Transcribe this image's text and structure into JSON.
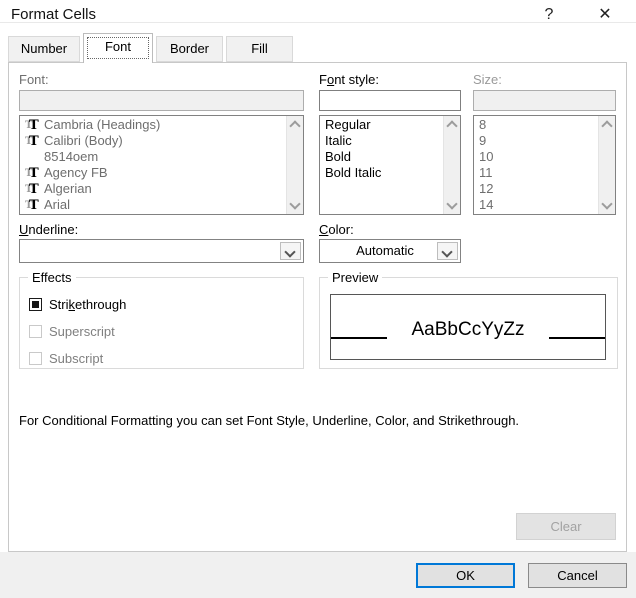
{
  "window": {
    "title": "Format Cells",
    "help_glyph": "?",
    "close_glyph": "✕"
  },
  "tabs": [
    {
      "label": "Number",
      "selected": false
    },
    {
      "label": "Font",
      "selected": true
    },
    {
      "label": "Border",
      "selected": false
    },
    {
      "label": "Fill",
      "selected": false
    }
  ],
  "font": {
    "label": "Font:",
    "value": "",
    "disabled": true,
    "items": [
      {
        "name": "Cambria (Headings)",
        "truetype": true
      },
      {
        "name": "Calibri (Body)",
        "truetype": true
      },
      {
        "name": "8514oem",
        "truetype": false
      },
      {
        "name": "Agency FB",
        "truetype": true
      },
      {
        "name": "Algerian",
        "truetype": true
      },
      {
        "name": "Arial",
        "truetype": true
      }
    ]
  },
  "font_style": {
    "label_pre": "F",
    "label_accel": "o",
    "label_post": "nt style:",
    "value": "",
    "items": [
      "Regular",
      "Italic",
      "Bold",
      "Bold Italic"
    ]
  },
  "size": {
    "label": "Size:",
    "value": "",
    "disabled": true,
    "items": [
      "8",
      "9",
      "10",
      "11",
      "12",
      "14"
    ]
  },
  "underline": {
    "label_pre": "",
    "label_accel": "U",
    "label_post": "nderline:",
    "value": ""
  },
  "color": {
    "label_pre": "",
    "label_accel": "C",
    "label_post": "olor:",
    "value": "Automatic"
  },
  "effects": {
    "title": "Effects",
    "options": [
      {
        "pre": "Stri",
        "accel": "k",
        "post": "ethrough",
        "state": "mixed",
        "disabled": false
      },
      {
        "pre": "Superscript",
        "accel": "",
        "post": "",
        "state": "unchecked",
        "disabled": true
      },
      {
        "pre": "Subscript",
        "accel": "",
        "post": "",
        "state": "unchecked",
        "disabled": true
      }
    ]
  },
  "preview": {
    "title": "Preview",
    "sample": "AaBbCcYyZz"
  },
  "note": "For Conditional Formatting you can set Font Style, Underline, Color, and Strikethrough.",
  "buttons": {
    "clear": {
      "label": "Clear",
      "disabled": true
    },
    "ok": {
      "label": "OK",
      "default": true
    },
    "cancel": {
      "label": "Cancel",
      "default": false
    }
  },
  "colors": {
    "accent": "#0078d7",
    "disabled_text": "#6e6e6e",
    "footer_bg": "#f0f0f0",
    "button_face": "#e1e1e1"
  }
}
